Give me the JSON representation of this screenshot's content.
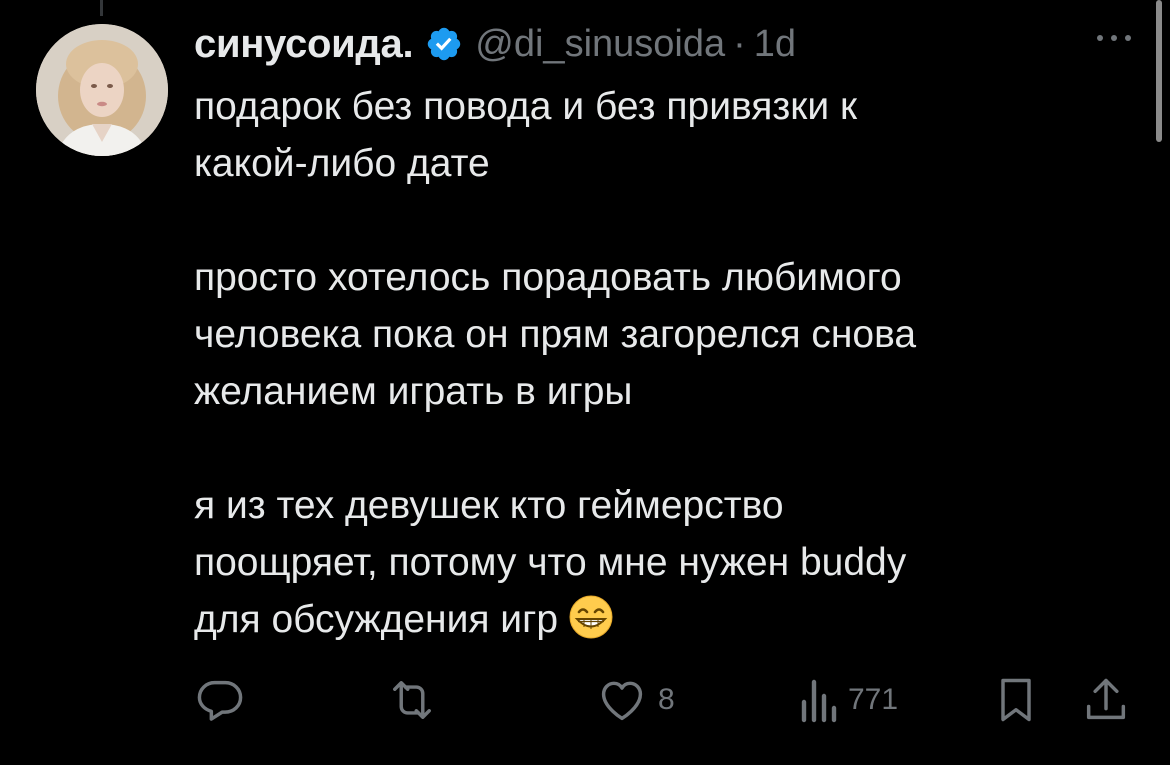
{
  "tweet": {
    "display_name": "синусоида.",
    "handle": "@di_sinusoida",
    "separator": "·",
    "time": "1d",
    "paragraphs": [
      [
        "подарок без повода и без привязки к",
        "какой-либо дате"
      ],
      [
        "просто хотелось порадовать любимого",
        "человека пока он прям загорелся снова",
        "желанием играть в игры"
      ],
      [
        "я из тех девушек кто геймерство",
        "поощряет, потому что мне нужен buddy",
        "для обсуждения игр"
      ]
    ],
    "emoji": "grinning-face-with-smiling-eyes"
  },
  "actions": {
    "reply_count": "",
    "retweet_count": "",
    "like_count": "8",
    "views_count": "771"
  },
  "colors": {
    "background": "#000000",
    "text": "#e7e9ea",
    "secondary": "#71767b",
    "verified": "#1d9bf0"
  }
}
